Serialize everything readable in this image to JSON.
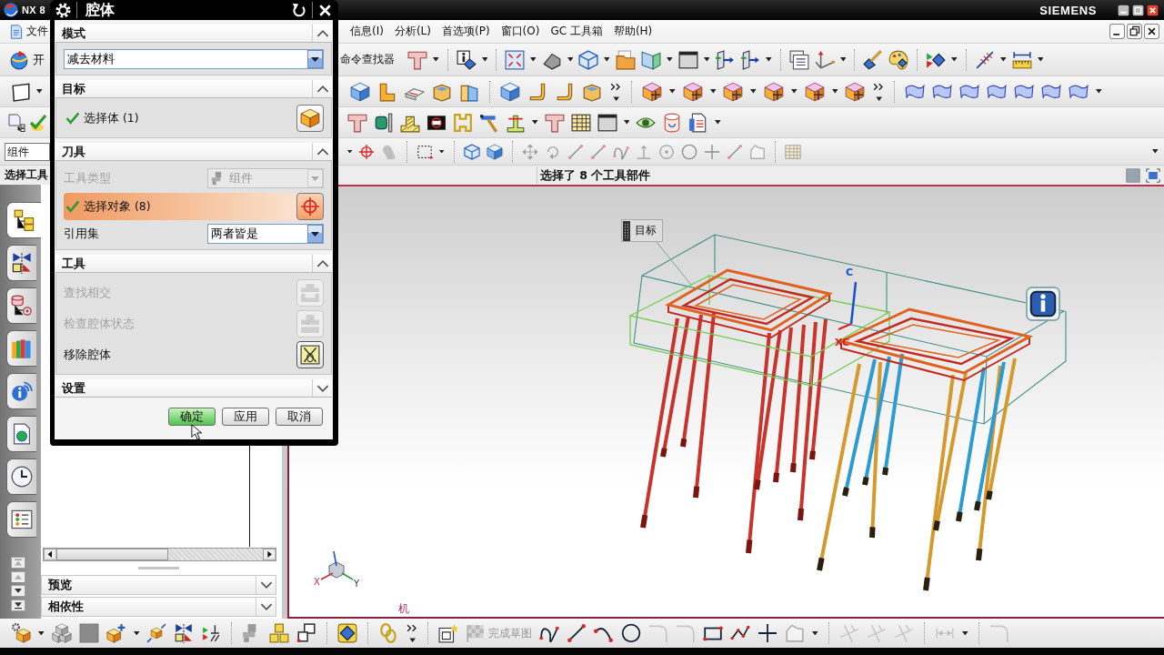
{
  "window": {
    "app_title": "NX 8",
    "brand": "SIEMENS"
  },
  "menu_bar": {
    "left_items": [
      "文件"
    ],
    "right_items": [
      "信息(I)",
      "分析(L)",
      "首选项(P)",
      "窗口(O)",
      "GC 工具箱",
      "帮助(H)"
    ]
  },
  "toolbars": {
    "start_label": "开",
    "command_finder": "命令查找器"
  },
  "selection_bar": {
    "type_filter": "组件"
  },
  "cue_line": {
    "prompt": "选择工具",
    "status": "选择了 8 个工具部件"
  },
  "dialog": {
    "title": "腔体",
    "sections": [
      {
        "title": "模式",
        "expanded": true,
        "rows": [
          {
            "kind": "dropdown",
            "value": "减去材料",
            "disabled": false
          }
        ]
      },
      {
        "title": "目标",
        "expanded": true,
        "rows": [
          {
            "kind": "selector",
            "label": "选择体 (1)",
            "complete": true,
            "selected": false
          }
        ]
      },
      {
        "title": "刀具",
        "expanded": true,
        "rows": [
          {
            "kind": "labeled_dropdown",
            "label": "工具类型",
            "value": "组件",
            "disabled": true
          },
          {
            "kind": "selector",
            "label": "选择对象 (8)",
            "complete": true,
            "selected": true
          },
          {
            "kind": "labeled_dropdown",
            "label": "引用集",
            "value": "两者皆是",
            "disabled": false
          }
        ]
      },
      {
        "title": "工具",
        "expanded": true,
        "rows": [
          {
            "kind": "action",
            "label": "查找相交",
            "disabled": true
          },
          {
            "kind": "action",
            "label": "检查腔体状态",
            "disabled": true
          },
          {
            "kind": "action",
            "label": "移除腔体",
            "disabled": false
          }
        ]
      },
      {
        "title": "设置",
        "expanded": false
      }
    ],
    "buttons": [
      {
        "label": "确定",
        "default": true
      },
      {
        "label": "应用",
        "default": false
      },
      {
        "label": "取消",
        "default": false
      }
    ]
  },
  "resource_bar": {
    "tabs": [
      {
        "selected": true
      },
      {
        "selected": false
      },
      {
        "selected": false
      },
      {
        "selected": false
      },
      {
        "selected": false
      },
      {
        "selected": false
      },
      {
        "selected": false
      },
      {
        "selected": false
      }
    ]
  },
  "navigator": {
    "panels": [
      {
        "title": "预览",
        "expanded": false
      },
      {
        "title": "相依性",
        "expanded": false
      }
    ]
  },
  "viewport": {
    "callout": "目标",
    "wcs_labels": [
      "C",
      "XC"
    ],
    "triad_labels": [
      "X",
      "Y"
    ],
    "corner_text": "机"
  },
  "sketch_toolbar": {
    "finish_sketch": {
      "label": "完成草图",
      "disabled": true
    }
  }
}
